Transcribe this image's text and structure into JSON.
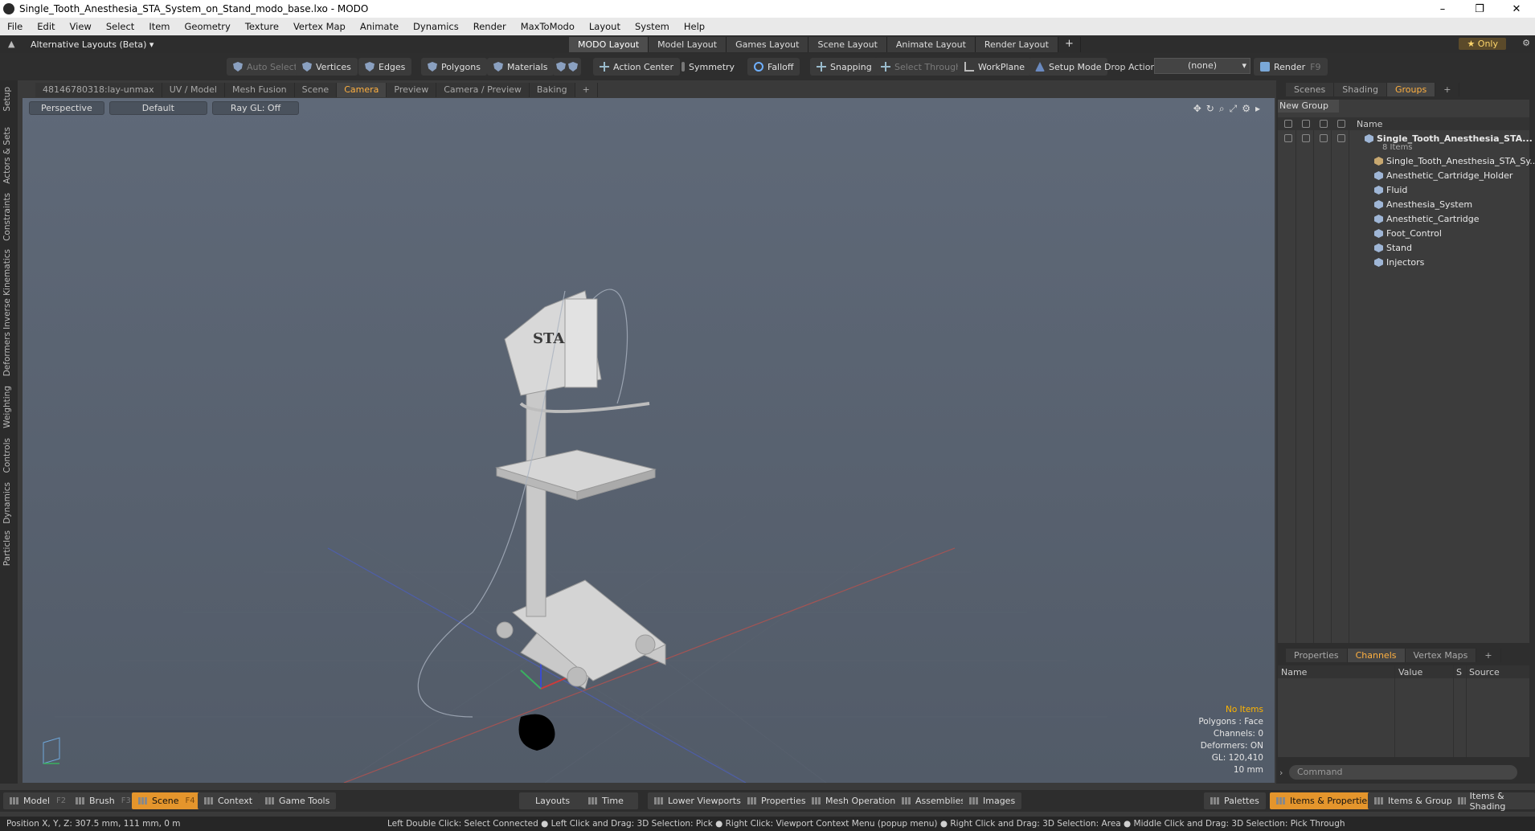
{
  "window": {
    "title": "Single_Tooth_Anesthesia_STA_System_on_Stand_modo_base.lxo - MODO",
    "controls": [
      "–",
      "❐",
      "✕"
    ]
  },
  "menu": [
    "File",
    "Edit",
    "View",
    "Select",
    "Item",
    "Geometry",
    "Texture",
    "Vertex Map",
    "Animate",
    "Dynamics",
    "Render",
    "MaxToModo",
    "Layout",
    "System",
    "Help"
  ],
  "layoutbar": {
    "alternative": "Alternative Layouts (Beta) ▾",
    "tabs": [
      "MODO Layout",
      "Model Layout",
      "Games Layout",
      "Scene Layout",
      "Animate Layout",
      "Render Layout",
      "+"
    ],
    "only": "★  Only"
  },
  "toolbar": {
    "auto_select": "Auto Select",
    "vertices": "Vertices",
    "edges": "Edges",
    "polygons": "Polygons",
    "materials": "Materials",
    "action_center": "Action Center",
    "symmetry": "Symmetry",
    "falloff": "Falloff",
    "snapping": "Snapping",
    "select_through": "Select Through",
    "workplane": "WorkPlane",
    "setup_mode": "Setup Mode",
    "drop_action": "Drop Action",
    "drop_value": "(none)",
    "render": "Render",
    "render_key": "F9"
  },
  "left_tabs": [
    "Setup",
    "Actors & Sets",
    "Constraints",
    "Inverse Kinematics",
    "Deformers",
    "Weighting",
    "Controls",
    "Dynamics",
    "Particles"
  ],
  "viewport_tabs": [
    "48146780318:lay-unmax",
    "UV / Model",
    "Mesh Fusion",
    "Scene",
    "Camera",
    "Preview",
    "Camera / Preview",
    "Baking",
    "+"
  ],
  "viewport": {
    "view": "Perspective",
    "style": "Default",
    "raygl": "Ray GL: Off",
    "info": {
      "items": "No Items",
      "polygons": "Polygons : Face",
      "channels": "Channels: 0",
      "deformers": "Deformers: ON",
      "gl": "GL: 120,410",
      "scale": "10 mm"
    },
    "product_brand": "STA"
  },
  "right_tabs": [
    "Scenes",
    "Shading",
    "Groups",
    "+"
  ],
  "groups": {
    "new_group": "New Group",
    "name_col": "Name",
    "root": "Single_Tooth_Anesthesia_STA...",
    "root_count": "8 Items",
    "items": [
      "Single_Tooth_Anesthesia_STA_Sy...",
      "Anesthetic_Cartridge_Holder",
      "Fluid",
      "Anesthesia_System",
      "Anesthetic_Cartridge",
      "Foot_Control",
      "Stand",
      "Injectors"
    ]
  },
  "channel_tabs": [
    "Properties",
    "Channels",
    "Vertex Maps",
    "+"
  ],
  "channels": {
    "name": "Name",
    "value": "Value",
    "s": "S",
    "source": "Source"
  },
  "command_placeholder": "Command",
  "bottombar": {
    "model": "Model",
    "model_key": "F2",
    "brush": "Brush",
    "brush_key": "F3",
    "scene": "Scene",
    "scene_key": "F4",
    "context": "Context",
    "game_tools": "Game Tools",
    "layouts": "Layouts",
    "time": "Time",
    "lower_viewports": "Lower Viewports",
    "properties": "Properties",
    "mesh_operations": "Mesh Operations",
    "assemblies": "Assemblies",
    "images": "Images",
    "palettes": "Palettes",
    "items_properties": "Items & Properties",
    "items_groups": "Items & Groups",
    "items_shading": "Items & Shading"
  },
  "status": {
    "position": "Position X, Y, Z:   307.5 mm, 111 mm, 0 m",
    "hint": "Left Double Click: Select Connected ● Left Click and Drag: 3D Selection: Pick ● Right Click: Viewport Context Menu (popup menu) ● Right Click and Drag: 3D Selection: Area ● Middle Click and Drag: 3D Selection: Pick Through"
  },
  "colors": {
    "accent": "#e4952c",
    "viewport_top": "#5f6978",
    "viewport_bottom": "#525b68"
  }
}
